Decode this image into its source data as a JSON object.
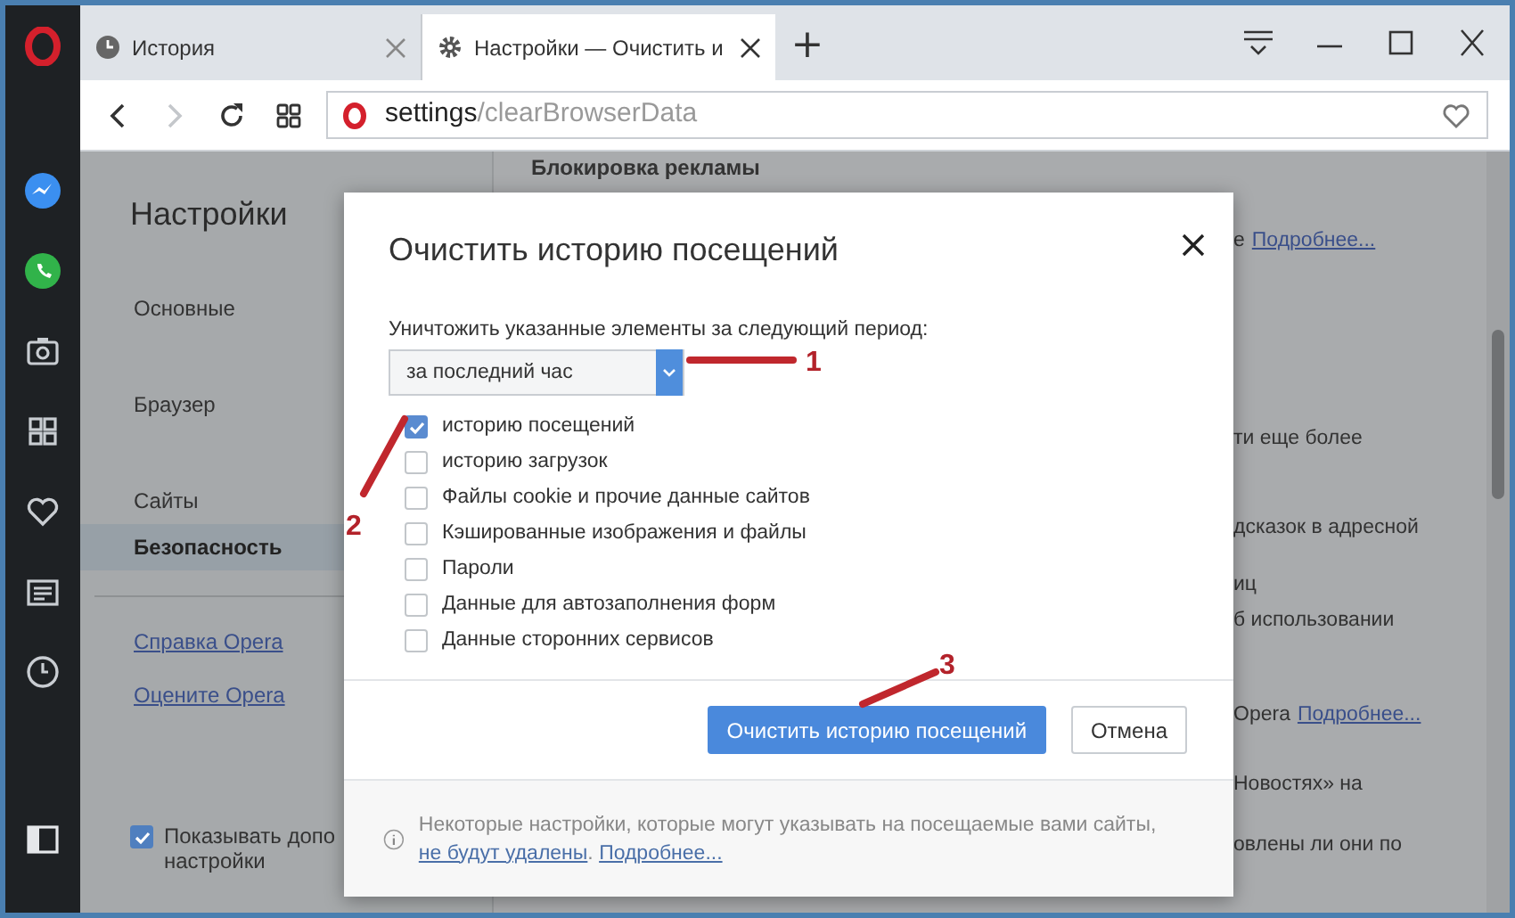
{
  "tabs": [
    {
      "label": "История",
      "selected": false
    },
    {
      "label": "Настройки — Очистить и",
      "selected": true
    }
  ],
  "new_tab": "+",
  "address": {
    "host": "settings",
    "path": "/clearBrowserData"
  },
  "nav": {
    "title": "Настройки",
    "items": [
      {
        "label": "Основные",
        "selected": false
      },
      {
        "label": "Браузер",
        "selected": false
      },
      {
        "label": "Сайты",
        "selected": false
      },
      {
        "label": "Безопасность",
        "selected": true
      }
    ],
    "links": [
      "Справка Opera",
      "Оцените Opera"
    ],
    "show_advanced": {
      "label_lines": [
        "Показывать допо",
        "настройки"
      ],
      "checked": true
    }
  },
  "page_fragments": [
    {
      "text": "Блокировка рекламы",
      "kind": "heading"
    },
    {
      "text": "е",
      "link": "Подробнее...",
      "kind": "line"
    },
    {
      "text": "ти еще более",
      "kind": "line"
    },
    {
      "text": "дсказок в адресной",
      "kind": "line"
    },
    {
      "text": "иц",
      "kind": "line"
    },
    {
      "text": "б использовании",
      "kind": "line"
    },
    {
      "text": "Opera",
      "link": "Подробнее...",
      "kind": "line"
    },
    {
      "text": "Новостях» на",
      "kind": "line"
    },
    {
      "text": "овлены ли они по",
      "kind": "line"
    }
  ],
  "dialog": {
    "title": "Очистить историю посещений",
    "period_label": "Уничтожить указанные элементы за следующий период:",
    "period": "за последний час",
    "options": [
      {
        "label": "историю посещений",
        "checked": true
      },
      {
        "label": "историю загрузок",
        "checked": false
      },
      {
        "label": "Файлы cookie и прочие данные сайтов",
        "checked": false
      },
      {
        "label": "Кэшированные изображения и файлы",
        "checked": false
      },
      {
        "label": "Пароли",
        "checked": false
      },
      {
        "label": "Данные для автозаполнения форм",
        "checked": false
      },
      {
        "label": "Данные сторонних сервисов",
        "checked": false
      }
    ],
    "confirm": "Очистить историю посещений",
    "cancel": "Отмена",
    "note": {
      "text": "Некоторые настройки, которые могут указывать на посещаемые вами сайты,",
      "link": "не будут удалены",
      "after": ".",
      "more": "Подробнее..."
    }
  },
  "annotations": [
    {
      "number": "1"
    },
    {
      "number": "2"
    },
    {
      "number": "3"
    }
  ]
}
